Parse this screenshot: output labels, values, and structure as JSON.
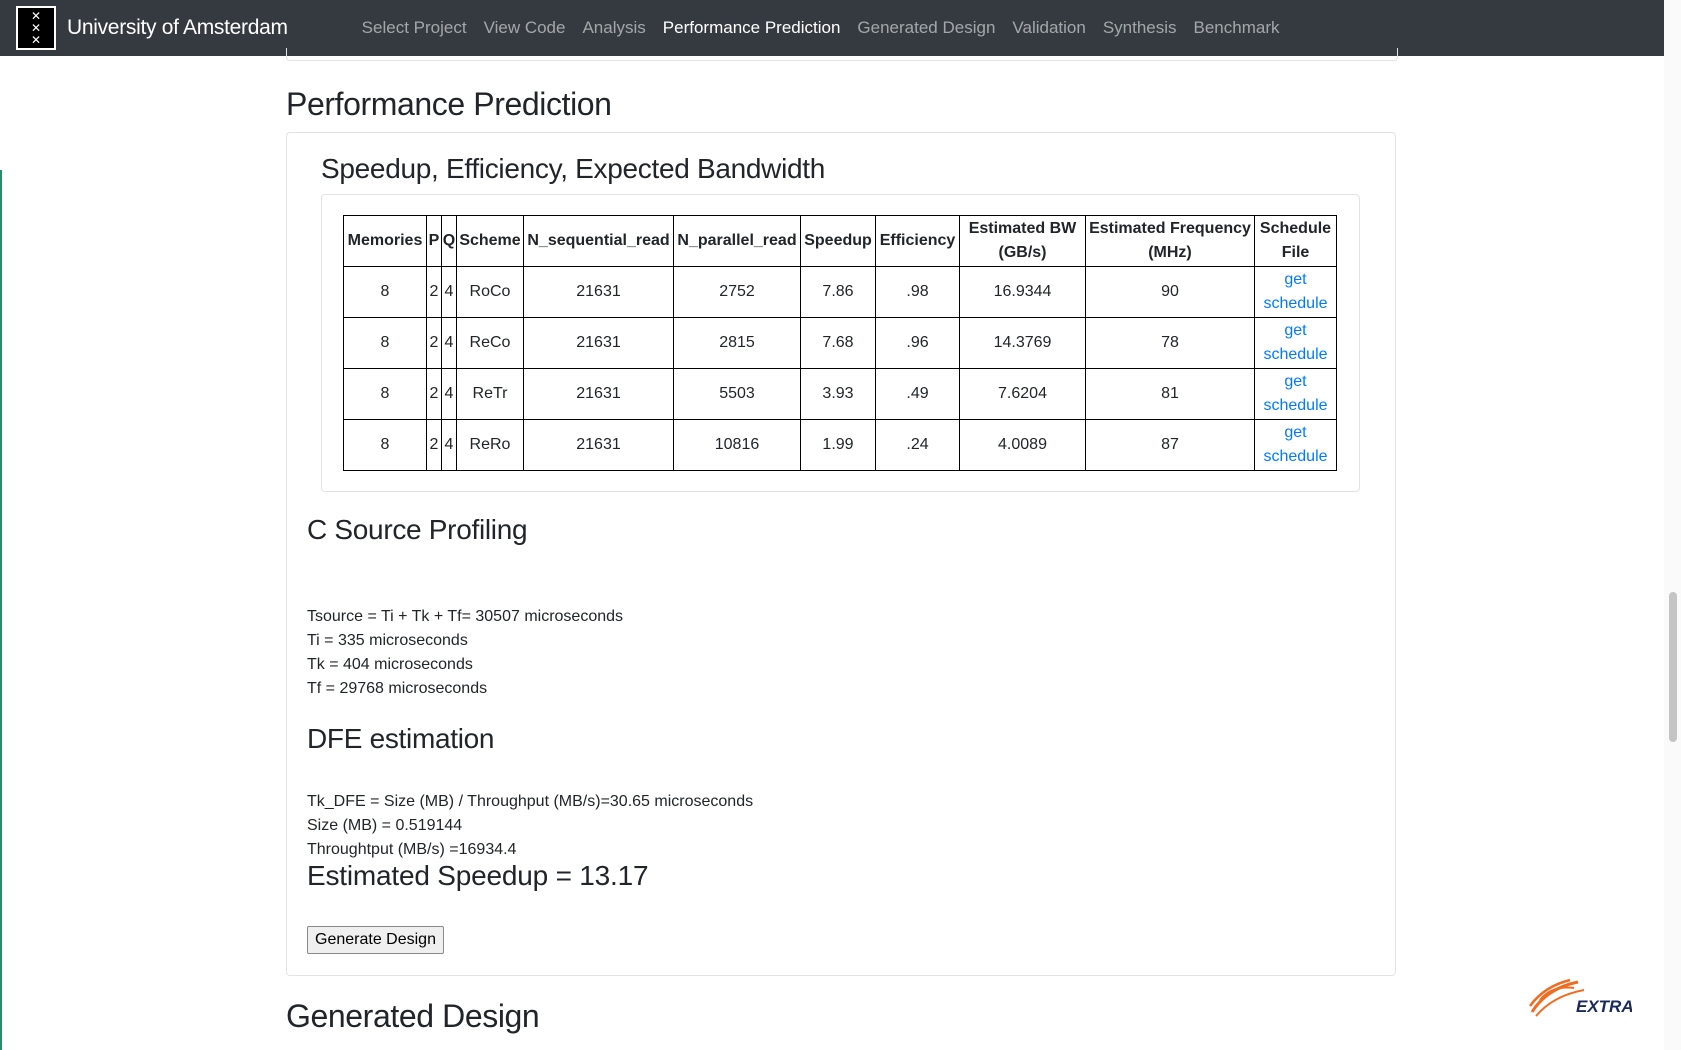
{
  "navbar": {
    "brand": "University of Amsterdam",
    "items": [
      {
        "label": "Select Project",
        "active": false
      },
      {
        "label": "View Code",
        "active": false
      },
      {
        "label": "Analysis",
        "active": false
      },
      {
        "label": "Performance Prediction",
        "active": true
      },
      {
        "label": "Generated Design",
        "active": false
      },
      {
        "label": "Validation",
        "active": false
      },
      {
        "label": "Synthesis",
        "active": false
      },
      {
        "label": "Benchmark",
        "active": false
      }
    ]
  },
  "page": {
    "title": "Performance Prediction",
    "subtitle": "Speedup, Efficiency, Expected Bandwidth"
  },
  "table": {
    "headers": [
      "Memories",
      "P",
      "Q",
      "Scheme",
      "N_sequential_read",
      "N_parallel_read",
      "Speedup",
      "Efficiency",
      "Estimated BW (GB/s)",
      "Estimated Frequency (MHz)",
      "Schedule File"
    ],
    "link_label": "get schedule",
    "rows": [
      [
        "8",
        "2",
        "4",
        "RoCo",
        "21631",
        "2752",
        "7.86",
        ".98",
        "16.9344",
        "90"
      ],
      [
        "8",
        "2",
        "4",
        "ReCo",
        "21631",
        "2815",
        "7.68",
        ".96",
        "14.3769",
        "78"
      ],
      [
        "8",
        "2",
        "4",
        "ReTr",
        "21631",
        "5503",
        "3.93",
        ".49",
        "7.6204",
        "81"
      ],
      [
        "8",
        "2",
        "4",
        "ReRo",
        "21631",
        "10816",
        "1.99",
        ".24",
        "4.0089",
        "87"
      ]
    ]
  },
  "profiling": {
    "title": "C Source Profiling",
    "tsource": "Tsource = Ti + Tk + Tf= 30507 microseconds",
    "ti": "Ti = 335 microseconds",
    "tk": "Tk = 404 microseconds",
    "tf": "Tf = 29768 microseconds"
  },
  "dfe": {
    "title": "DFE estimation",
    "tk_dfe": "Tk_DFE = Size (MB) / Throughput (MB/s)=30.65 microseconds",
    "size": "Size (MB) = 0.519144",
    "throughput": "Throughtput (MB/s) =16934.4",
    "speedup": "Estimated Speedup = 13.17"
  },
  "buttons": {
    "generate_design": "Generate Design"
  },
  "next_section": {
    "title": "Generated Design"
  },
  "footer_logo": {
    "text": "EXTRA"
  },
  "colors": {
    "navbar_bg": "#343a40",
    "link": "#007bff",
    "logo_orange": "#f26b21"
  },
  "icons": {
    "brand_logo": "uva-crest-icon",
    "footer_logo": "extra-logo-icon"
  }
}
